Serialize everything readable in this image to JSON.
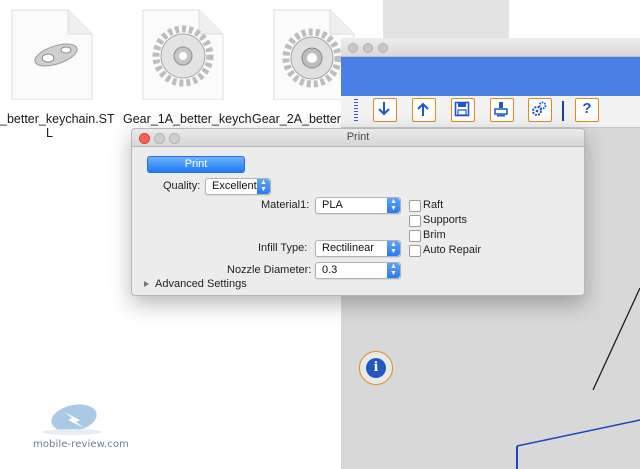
{
  "finder": {
    "files": [
      {
        "name_line1": "_better_keychain.ST",
        "name_line2": "L",
        "thumb": "keychain-model-icon"
      },
      {
        "name_line1": "Gear_1A_better_keych",
        "thumb": "gear-model-icon"
      },
      {
        "name_line1": "Gear_2A_better_",
        "thumb": "gear-model-icon"
      }
    ],
    "watermark": "mobile-review.com"
  },
  "app": {
    "toolbar_icons": [
      "download-arrow-icon",
      "upload-arrow-icon",
      "save-icon",
      "printer-icon",
      "settings-gears-icon",
      "help-icon"
    ],
    "help_label": "?",
    "info_label": "i",
    "accent_color": "#4a7fe6",
    "button_border_color": "#e08a1e"
  },
  "dialog": {
    "title": "Print",
    "print_button": "Print",
    "quality_label": "Quality:",
    "quality_value": "Excellent",
    "material_label": "Material1:",
    "material_value": "PLA",
    "infill_label": "Infill Type:",
    "infill_value": "Rectilinear",
    "nozzle_label": "Nozzle Diameter:",
    "nozzle_value": "0.3",
    "checkboxes": [
      {
        "label": "Raft",
        "checked": false
      },
      {
        "label": "Supports",
        "checked": false
      },
      {
        "label": "Brim",
        "checked": false
      },
      {
        "label": "Auto Repair",
        "checked": false
      }
    ],
    "advanced_label": "Advanced Settings"
  }
}
